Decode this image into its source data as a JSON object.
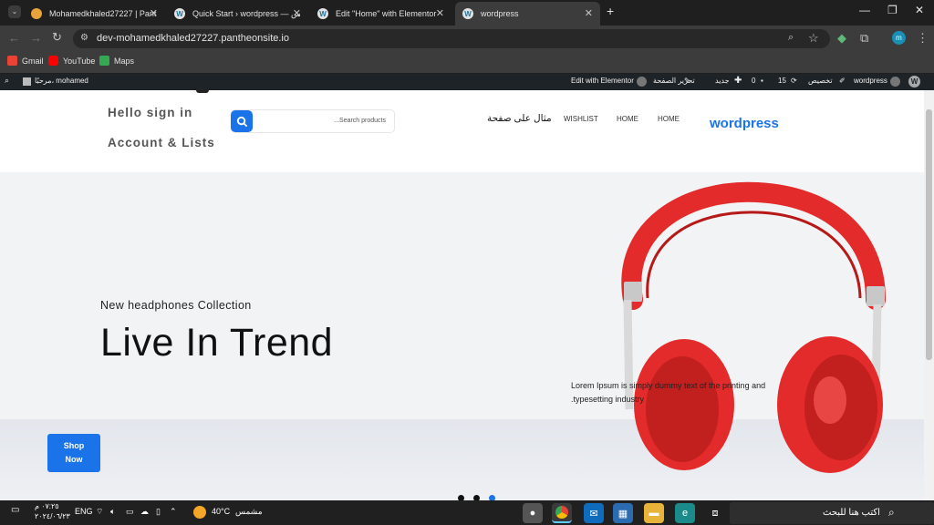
{
  "browser": {
    "tabs": [
      {
        "title": "Mohamedkhaled27227 | Panthe",
        "active": false
      },
      {
        "title": "Quick Start › wordpress — ريس",
        "active": false
      },
      {
        "title": "Edit \"Home\" with Elementor",
        "active": false
      },
      {
        "title": "wordpress",
        "active": true
      }
    ],
    "new_tab": "+",
    "url": "dev-mohamedkhaled27227.pantheonsite.io",
    "profile_initial": "m",
    "bookmarks": [
      "Gmail",
      "YouTube",
      "Maps"
    ]
  },
  "adminbar": {
    "site": "wordpress",
    "customize": "تخصيص",
    "updates": "15",
    "comments": "0",
    "new": "جديد",
    "edit_page": "تحرير الصفحة",
    "edit_elementor": "Edit with Elementor",
    "greeting": "مرحبًا، mohamed"
  },
  "header": {
    "brand": "wordpress",
    "nav": [
      "HOME",
      "HOME",
      "WISHLIST",
      "مثال على صفحة"
    ],
    "search_placeholder": "...Search products",
    "hello": "Hello  sign  in",
    "account": "Account  &  Lists"
  },
  "hero": {
    "subtitle": "New headphones Collection",
    "headline": "Live In Trend",
    "description": "Lorem Ipsum is simply dummy text of the printing and typesetting industry.",
    "cta_line1": "Shop",
    "cta_line2": "Now",
    "slides": 3,
    "active_slide": 3,
    "colors": {
      "accent": "#1a73e8",
      "headphone": "#e32b2b"
    }
  },
  "taskbar": {
    "search": "اكتب هنا للبحث",
    "weather_temp": "40°C",
    "weather_text": "مشمس",
    "lang": "ENG",
    "time": "٠٧:٢٥ م",
    "date": "٢٠٢٤/٠٦/٢٣"
  }
}
